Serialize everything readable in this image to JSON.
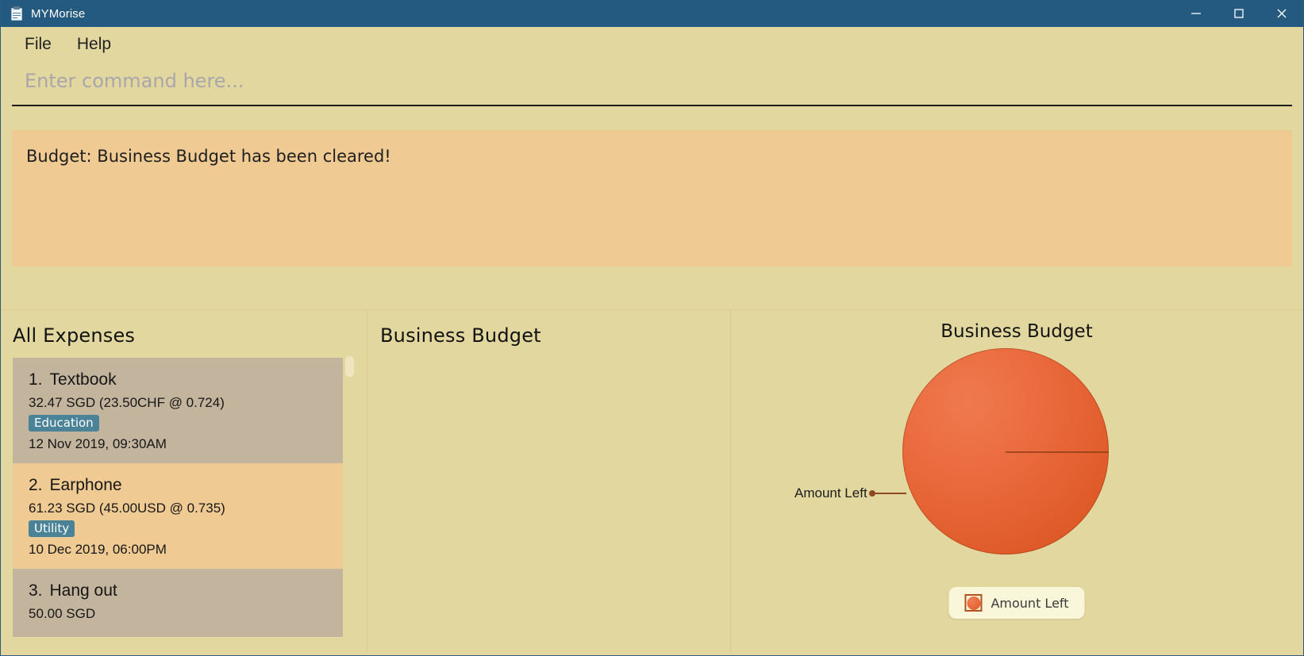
{
  "window": {
    "title": "MYMorise",
    "app_icon": "clipboard-icon",
    "controls": {
      "minimize": "minimize-icon",
      "maximize": "maximize-icon",
      "close": "close-icon"
    },
    "titlebar_color": "#245a80",
    "background_color": "#e2d79f"
  },
  "menubar": {
    "items": [
      {
        "label": "File"
      },
      {
        "label": "Help"
      }
    ]
  },
  "command": {
    "value": "",
    "placeholder": "Enter command here..."
  },
  "result": {
    "message": "Budget: Business Budget has been cleared!",
    "background_color": "#f0ca93"
  },
  "expenses_panel": {
    "title": "All Expenses",
    "items": [
      {
        "index": "1.",
        "name": "Textbook",
        "amount": "32.47 SGD  (23.50CHF @ 0.724)",
        "tag": "Education",
        "date": "12 Nov 2019, 09:30AM"
      },
      {
        "index": "2.",
        "name": "Earphone",
        "amount": "61.23 SGD  (45.00USD @ 0.735)",
        "tag": "Utility",
        "date": "10 Dec 2019, 06:00PM"
      },
      {
        "index": "3.",
        "name": "Hang out",
        "amount": "50.00 SGD",
        "tag": "",
        "date": ""
      }
    ],
    "tag_color": "#4a8298",
    "row_color_a": "#c2b49d",
    "row_color_b": "#f0ca93"
  },
  "budget_panel": {
    "title": "Business Budget"
  },
  "chart_data": {
    "type": "pie",
    "title": "Business Budget",
    "categories": [
      "Amount Left"
    ],
    "values": [
      100
    ],
    "value_unit": "percent",
    "slice_colors": [
      "#e8693c"
    ],
    "legend": {
      "position": "bottom",
      "entries": [
        "Amount Left"
      ]
    },
    "annotations": [
      "Amount Left"
    ]
  }
}
